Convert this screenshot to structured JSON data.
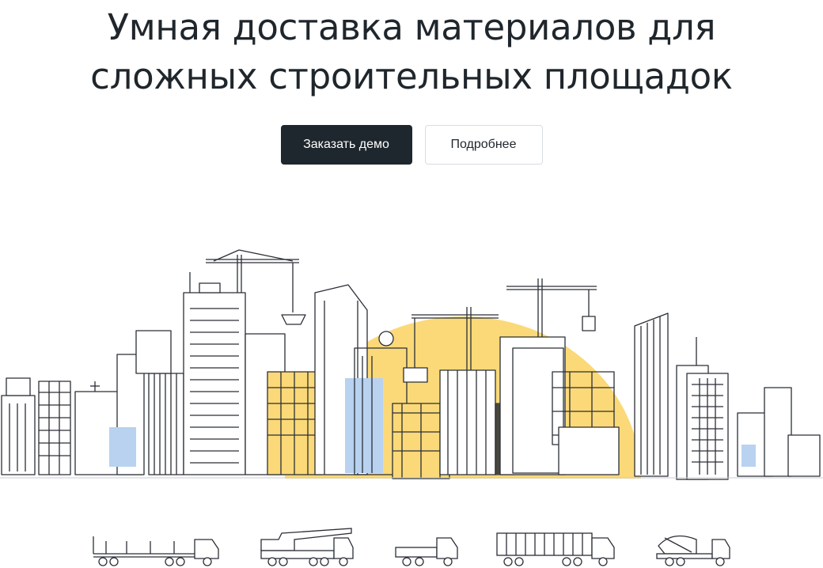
{
  "hero": {
    "title_line1": "Умная доставка материалов для",
    "title_line2": "сложных строительных площадок"
  },
  "cta": {
    "primary_label": "Заказать демо",
    "secondary_label": "Подробнее"
  },
  "illustration": {
    "subject": "city-skyline-construction",
    "colors": {
      "sun": "#fbd978",
      "window_blue": "#b8d2f0",
      "ink": "#2a2f36"
    }
  },
  "vehicles": [
    {
      "icon": "flatbed-truck-icon"
    },
    {
      "icon": "crane-truck-icon"
    },
    {
      "icon": "small-truck-icon"
    },
    {
      "icon": "container-truck-icon"
    },
    {
      "icon": "concrete-mixer-icon"
    }
  ]
}
